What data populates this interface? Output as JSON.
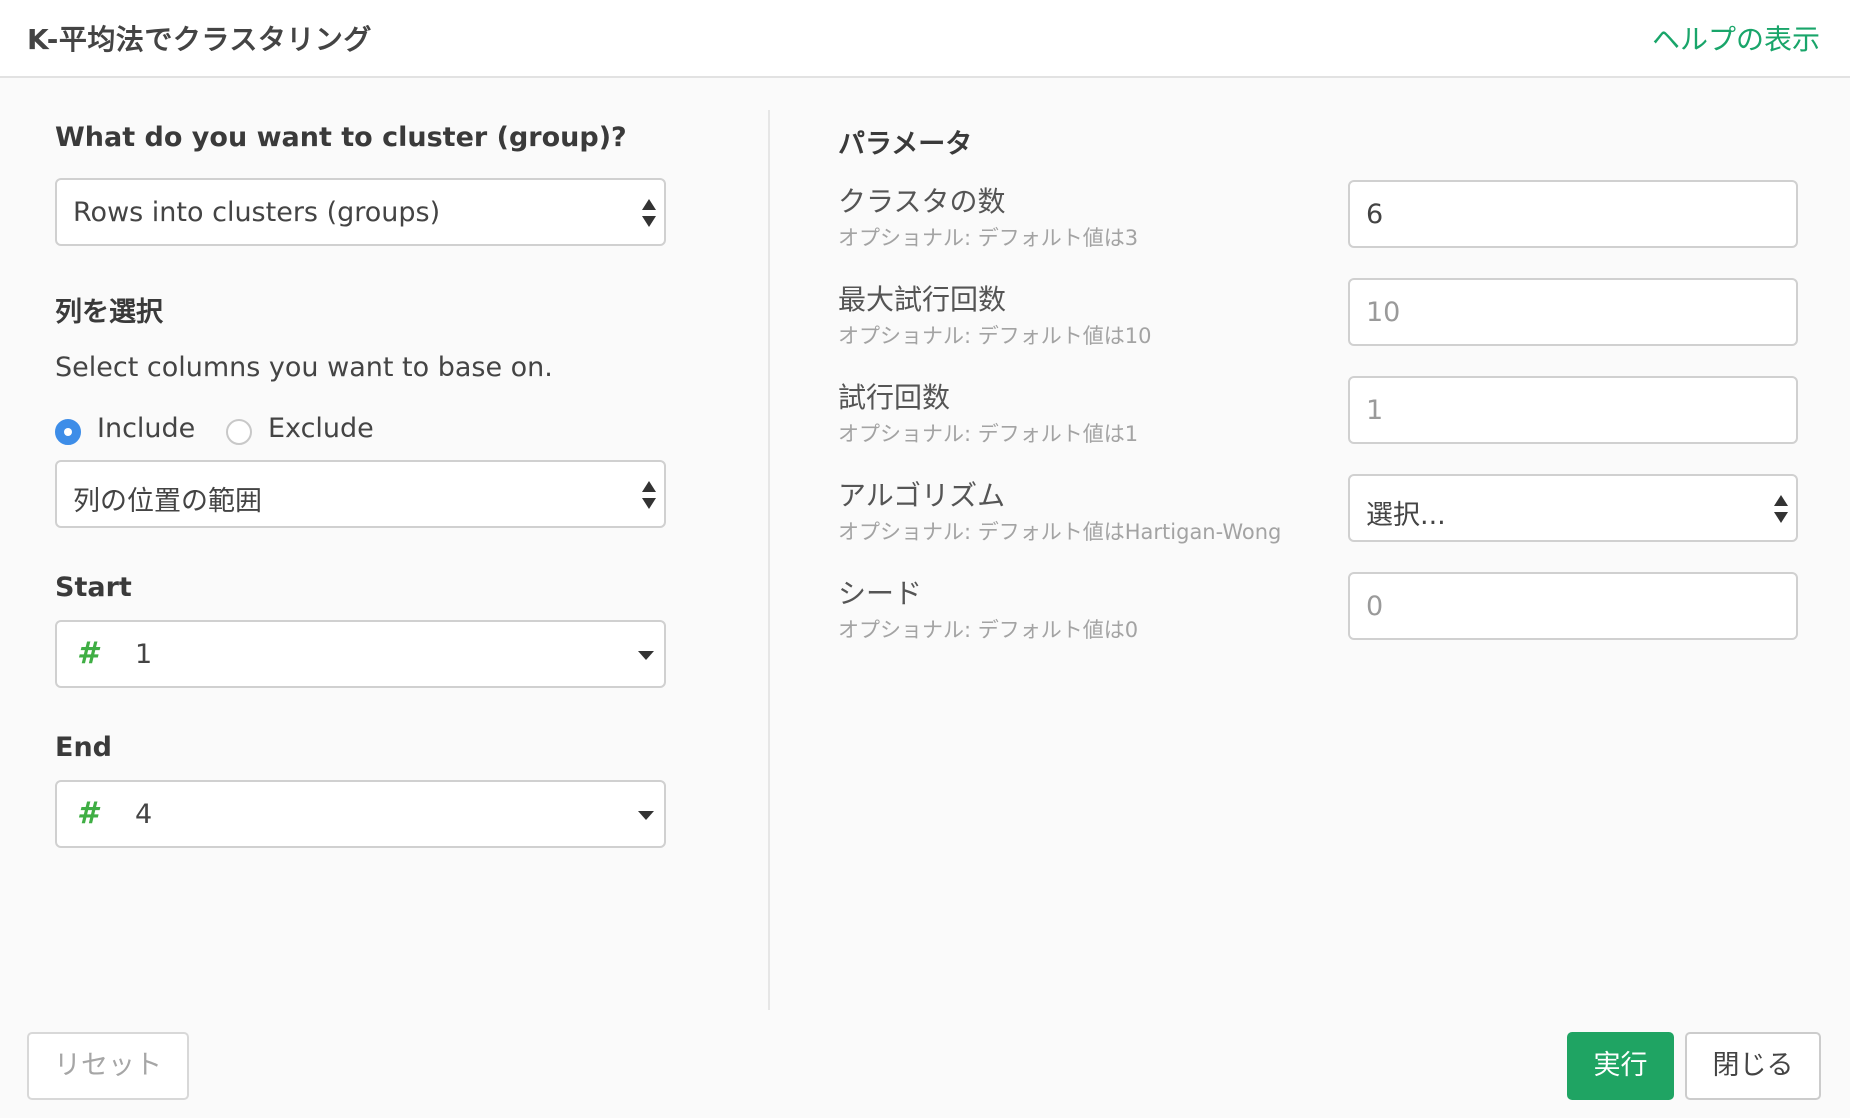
{
  "header": {
    "title": "K-平均法でクラスタリング",
    "help_link": "ヘルプの表示"
  },
  "left": {
    "cluster_question": "What do you want to cluster (group)?",
    "cluster_select_value": "Rows into clusters (groups)",
    "column_section_title": "列を選択",
    "column_instruction": "Select columns you want to base on.",
    "radio_include": "Include",
    "radio_exclude": "Exclude",
    "radio_selected": "Include",
    "column_mode_value": "列の位置の範囲",
    "start_label": "Start",
    "start_value": "1",
    "end_label": "End",
    "end_value": "4",
    "number_icon": "#"
  },
  "params": {
    "title": "パラメータ",
    "items": [
      {
        "label": "クラスタの数",
        "hint": "オプショナル: デフォルト値は3",
        "value": "6",
        "kind": "input"
      },
      {
        "label": "最大試行回数",
        "hint": "オプショナル: デフォルト値は10",
        "value": "10",
        "kind": "input-placeholder"
      },
      {
        "label": "試行回数",
        "hint": "オプショナル: デフォルト値は1",
        "value": "1",
        "kind": "input-placeholder"
      },
      {
        "label": "アルゴリズム",
        "hint": "オプショナル: デフォルト値はHartigan-Wong",
        "value": "選択...",
        "kind": "select"
      },
      {
        "label": "シード",
        "hint": "オプショナル: デフォルト値は0",
        "value": "0",
        "kind": "input-placeholder"
      }
    ]
  },
  "footer": {
    "reset_label": "リセット",
    "run_label": "実行",
    "close_label": "閉じる"
  },
  "colors": {
    "accent_green": "#1fa463",
    "link_green": "#19a56a",
    "radio_blue": "#3d8de8",
    "number_icon_green": "#3fae44"
  }
}
